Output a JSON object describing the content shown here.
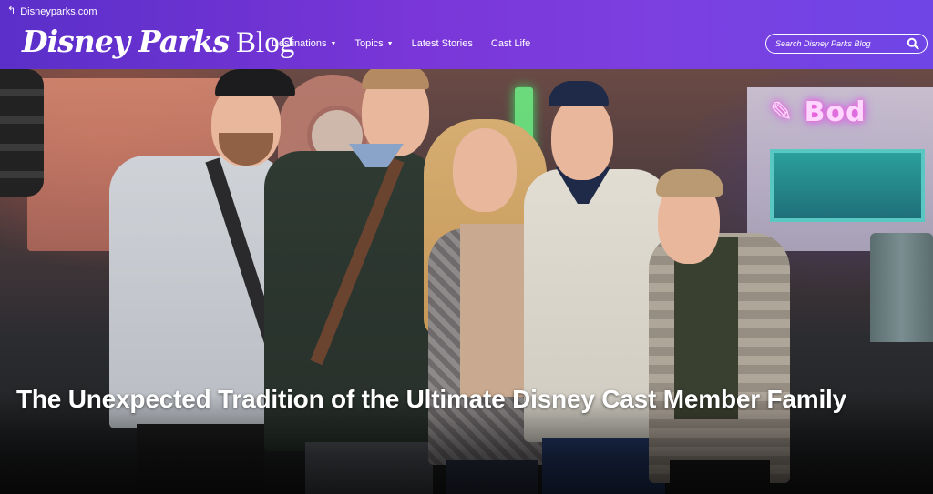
{
  "header": {
    "back_link_label": "Disneyparks.com",
    "logo": {
      "brand1": "Disney",
      "brand2": "Parks",
      "blog": "Blog"
    },
    "nav": [
      {
        "label": "Destinations",
        "has_dropdown": true
      },
      {
        "label": "Topics",
        "has_dropdown": true
      },
      {
        "label": "Latest Stories",
        "has_dropdown": false
      },
      {
        "label": "Cast Life",
        "has_dropdown": false
      }
    ],
    "search": {
      "placeholder": "Search Disney Parks Blog",
      "icon": "search-icon"
    }
  },
  "hero": {
    "title": "The Unexpected Tradition of the Ultimate Disney Cast Member Family",
    "image_alt": "Family of five posing together at night in a Disney park"
  },
  "colors": {
    "header_gradient_start": "#5b2fc9",
    "header_gradient_end": "#6f45e6",
    "text_on_header": "#ffffff"
  }
}
